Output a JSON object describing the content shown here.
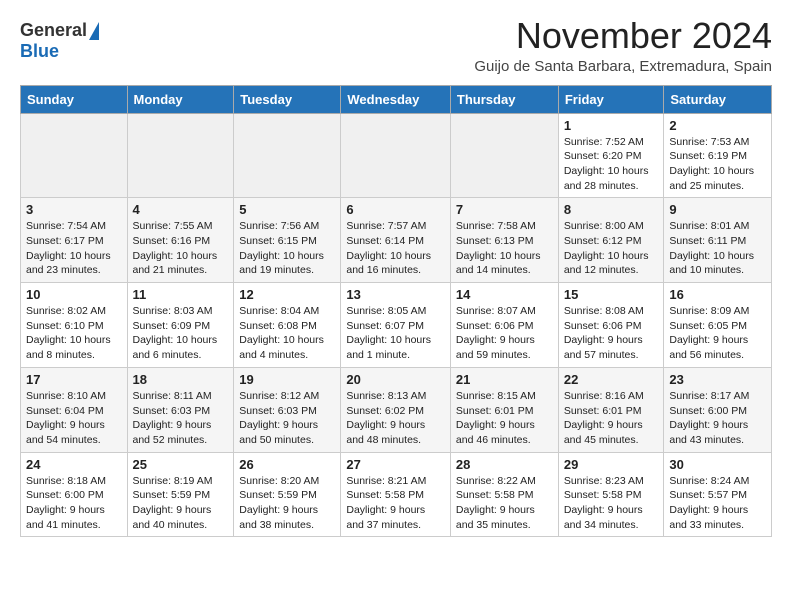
{
  "header": {
    "logo_general": "General",
    "logo_blue": "Blue",
    "month_title": "November 2024",
    "location": "Guijo de Santa Barbara, Extremadura, Spain"
  },
  "weekdays": [
    "Sunday",
    "Monday",
    "Tuesday",
    "Wednesday",
    "Thursday",
    "Friday",
    "Saturday"
  ],
  "weeks": [
    [
      {
        "day": "",
        "info": ""
      },
      {
        "day": "",
        "info": ""
      },
      {
        "day": "",
        "info": ""
      },
      {
        "day": "",
        "info": ""
      },
      {
        "day": "",
        "info": ""
      },
      {
        "day": "1",
        "info": "Sunrise: 7:52 AM\nSunset: 6:20 PM\nDaylight: 10 hours and 28 minutes."
      },
      {
        "day": "2",
        "info": "Sunrise: 7:53 AM\nSunset: 6:19 PM\nDaylight: 10 hours and 25 minutes."
      }
    ],
    [
      {
        "day": "3",
        "info": "Sunrise: 7:54 AM\nSunset: 6:17 PM\nDaylight: 10 hours and 23 minutes."
      },
      {
        "day": "4",
        "info": "Sunrise: 7:55 AM\nSunset: 6:16 PM\nDaylight: 10 hours and 21 minutes."
      },
      {
        "day": "5",
        "info": "Sunrise: 7:56 AM\nSunset: 6:15 PM\nDaylight: 10 hours and 19 minutes."
      },
      {
        "day": "6",
        "info": "Sunrise: 7:57 AM\nSunset: 6:14 PM\nDaylight: 10 hours and 16 minutes."
      },
      {
        "day": "7",
        "info": "Sunrise: 7:58 AM\nSunset: 6:13 PM\nDaylight: 10 hours and 14 minutes."
      },
      {
        "day": "8",
        "info": "Sunrise: 8:00 AM\nSunset: 6:12 PM\nDaylight: 10 hours and 12 minutes."
      },
      {
        "day": "9",
        "info": "Sunrise: 8:01 AM\nSunset: 6:11 PM\nDaylight: 10 hours and 10 minutes."
      }
    ],
    [
      {
        "day": "10",
        "info": "Sunrise: 8:02 AM\nSunset: 6:10 PM\nDaylight: 10 hours and 8 minutes."
      },
      {
        "day": "11",
        "info": "Sunrise: 8:03 AM\nSunset: 6:09 PM\nDaylight: 10 hours and 6 minutes."
      },
      {
        "day": "12",
        "info": "Sunrise: 8:04 AM\nSunset: 6:08 PM\nDaylight: 10 hours and 4 minutes."
      },
      {
        "day": "13",
        "info": "Sunrise: 8:05 AM\nSunset: 6:07 PM\nDaylight: 10 hours and 1 minute."
      },
      {
        "day": "14",
        "info": "Sunrise: 8:07 AM\nSunset: 6:06 PM\nDaylight: 9 hours and 59 minutes."
      },
      {
        "day": "15",
        "info": "Sunrise: 8:08 AM\nSunset: 6:06 PM\nDaylight: 9 hours and 57 minutes."
      },
      {
        "day": "16",
        "info": "Sunrise: 8:09 AM\nSunset: 6:05 PM\nDaylight: 9 hours and 56 minutes."
      }
    ],
    [
      {
        "day": "17",
        "info": "Sunrise: 8:10 AM\nSunset: 6:04 PM\nDaylight: 9 hours and 54 minutes."
      },
      {
        "day": "18",
        "info": "Sunrise: 8:11 AM\nSunset: 6:03 PM\nDaylight: 9 hours and 52 minutes."
      },
      {
        "day": "19",
        "info": "Sunrise: 8:12 AM\nSunset: 6:03 PM\nDaylight: 9 hours and 50 minutes."
      },
      {
        "day": "20",
        "info": "Sunrise: 8:13 AM\nSunset: 6:02 PM\nDaylight: 9 hours and 48 minutes."
      },
      {
        "day": "21",
        "info": "Sunrise: 8:15 AM\nSunset: 6:01 PM\nDaylight: 9 hours and 46 minutes."
      },
      {
        "day": "22",
        "info": "Sunrise: 8:16 AM\nSunset: 6:01 PM\nDaylight: 9 hours and 45 minutes."
      },
      {
        "day": "23",
        "info": "Sunrise: 8:17 AM\nSunset: 6:00 PM\nDaylight: 9 hours and 43 minutes."
      }
    ],
    [
      {
        "day": "24",
        "info": "Sunrise: 8:18 AM\nSunset: 6:00 PM\nDaylight: 9 hours and 41 minutes."
      },
      {
        "day": "25",
        "info": "Sunrise: 8:19 AM\nSunset: 5:59 PM\nDaylight: 9 hours and 40 minutes."
      },
      {
        "day": "26",
        "info": "Sunrise: 8:20 AM\nSunset: 5:59 PM\nDaylight: 9 hours and 38 minutes."
      },
      {
        "day": "27",
        "info": "Sunrise: 8:21 AM\nSunset: 5:58 PM\nDaylight: 9 hours and 37 minutes."
      },
      {
        "day": "28",
        "info": "Sunrise: 8:22 AM\nSunset: 5:58 PM\nDaylight: 9 hours and 35 minutes."
      },
      {
        "day": "29",
        "info": "Sunrise: 8:23 AM\nSunset: 5:58 PM\nDaylight: 9 hours and 34 minutes."
      },
      {
        "day": "30",
        "info": "Sunrise: 8:24 AM\nSunset: 5:57 PM\nDaylight: 9 hours and 33 minutes."
      }
    ]
  ]
}
